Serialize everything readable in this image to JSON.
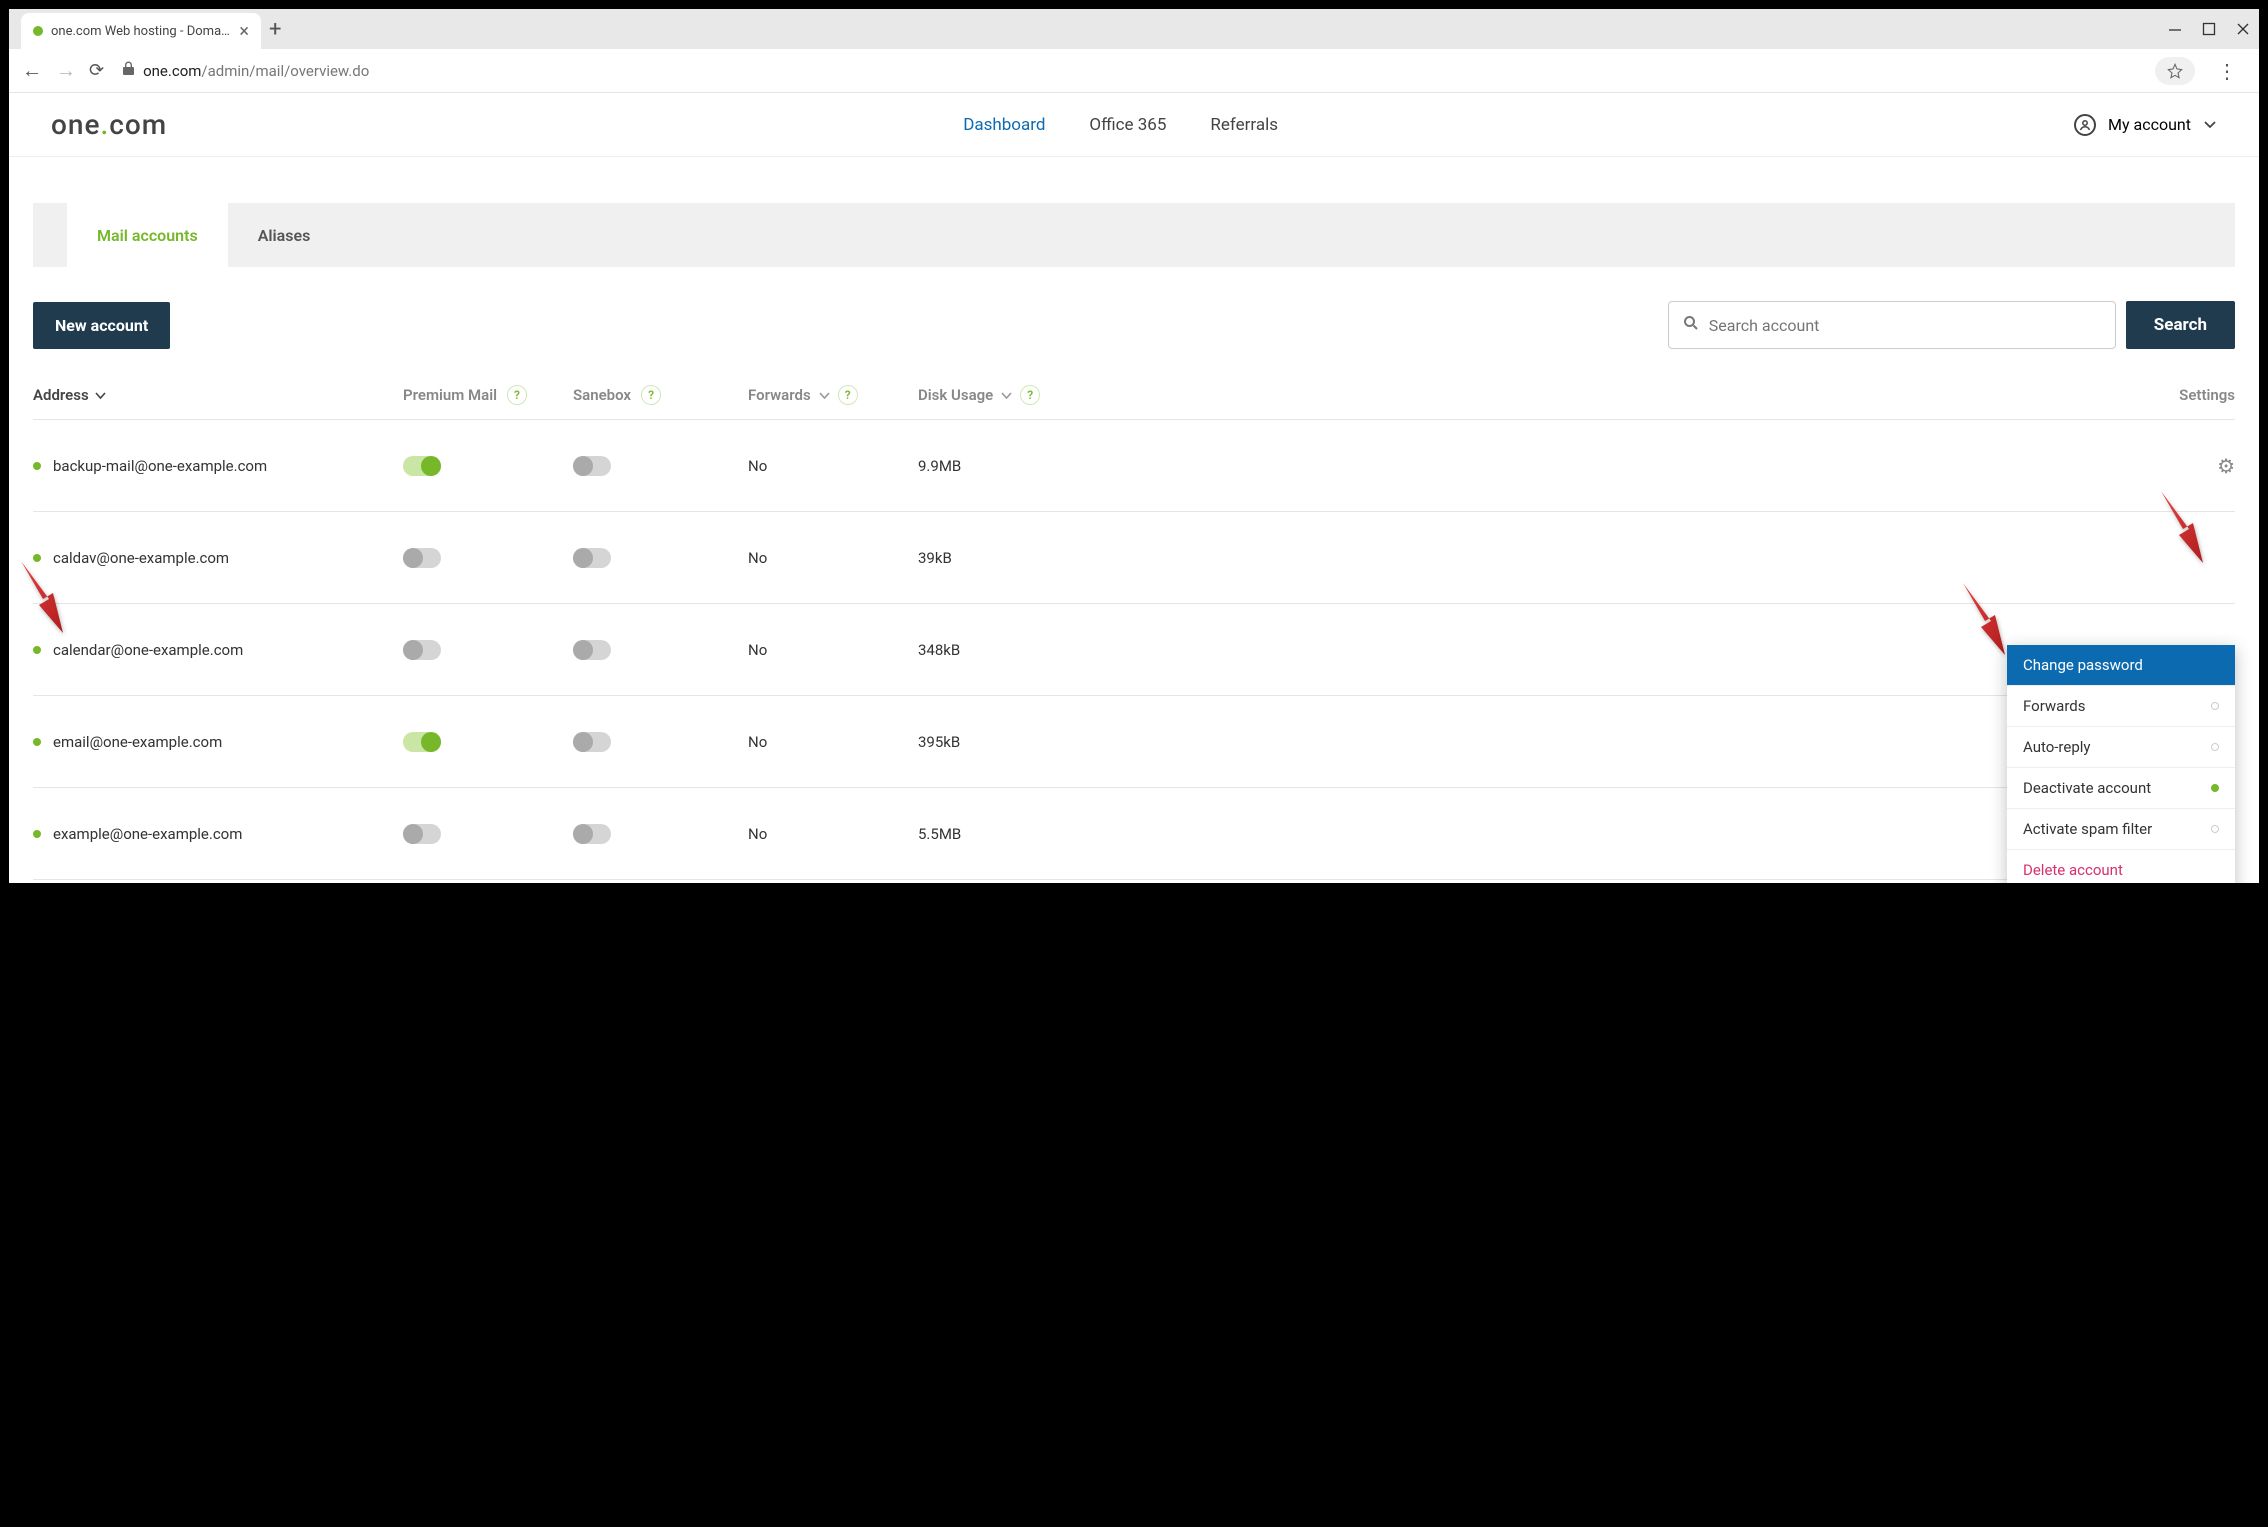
{
  "window": {
    "tab_title": "one.com Web hosting  -  Domain...",
    "url_host": "one.com",
    "url_path": "/admin/mail/overview.do"
  },
  "header": {
    "logo_pre": "one",
    "logo_post": "com",
    "nav": {
      "dashboard": "Dashboard",
      "office": "Office 365",
      "referrals": "Referrals"
    },
    "account": "My account"
  },
  "tabs": {
    "mail": "Mail accounts",
    "aliases": "Aliases"
  },
  "controls": {
    "new_account": "New account",
    "search_placeholder": "Search account",
    "search_btn": "Search"
  },
  "columns": {
    "address": "Address",
    "premium": "Premium Mail",
    "sanebox": "Sanebox",
    "forwards": "Forwards",
    "disk": "Disk Usage",
    "settings": "Settings"
  },
  "rows": [
    {
      "address": "backup-mail@one-example.com",
      "premium": true,
      "sanebox": false,
      "forwards": "No",
      "disk": "9.9MB"
    },
    {
      "address": "caldav@one-example.com",
      "premium": false,
      "sanebox": false,
      "forwards": "No",
      "disk": "39kB"
    },
    {
      "address": "calendar@one-example.com",
      "premium": false,
      "sanebox": false,
      "forwards": "No",
      "disk": "348kB"
    },
    {
      "address": "email@one-example.com",
      "premium": true,
      "sanebox": false,
      "forwards": "No",
      "disk": "395kB"
    },
    {
      "address": "example@one-example.com",
      "premium": false,
      "sanebox": false,
      "forwards": "No",
      "disk": "5.5MB"
    }
  ],
  "menu": {
    "change_password": "Change password",
    "forwards": "Forwards",
    "auto_reply": "Auto-reply",
    "deactivate": "Deactivate account",
    "spam": "Activate spam filter",
    "delete": "Delete account"
  }
}
